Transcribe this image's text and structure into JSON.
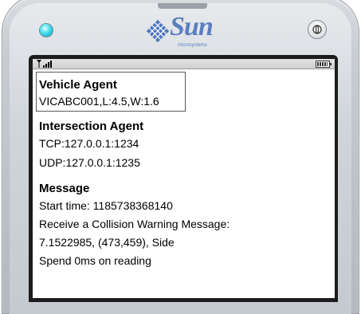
{
  "device": {
    "brand": "Sun",
    "brand_sub": "microsystems"
  },
  "vehicle_agent": {
    "heading": "Vehicle Agent",
    "value": "VICABC001,L:4.5,W:1.6"
  },
  "intersection_agent": {
    "heading": "Intersection Agent",
    "tcp": "TCP:127.0.0.1:1234",
    "udp": "UDP:127.0.0.1:1235"
  },
  "message": {
    "heading": "Message",
    "lines": [
      "Start time: 1185738368140",
      "Receive a Collision Warning Message:",
      "7.1522985, (473,459), Side",
      "Spend 0ms on reading"
    ]
  }
}
